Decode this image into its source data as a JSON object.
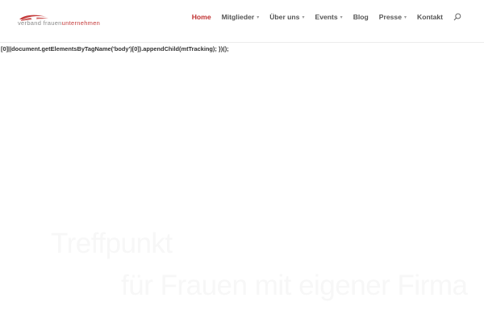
{
  "logo": {
    "text_part1": "verband frauen",
    "text_part2": "unternehmen",
    "brand_color": "#c43a3a"
  },
  "nav": {
    "items": [
      {
        "label": "Home",
        "active": true,
        "has_dropdown": false
      },
      {
        "label": "Mitglieder",
        "active": false,
        "has_dropdown": true
      },
      {
        "label": "Über uns",
        "active": false,
        "has_dropdown": true
      },
      {
        "label": "Events",
        "active": false,
        "has_dropdown": true
      },
      {
        "label": "Blog",
        "active": false,
        "has_dropdown": false
      },
      {
        "label": "Presse",
        "active": false,
        "has_dropdown": true
      },
      {
        "label": "Kontakt",
        "active": false,
        "has_dropdown": false
      }
    ],
    "active_color": "#c03030",
    "search_icon": "search-icon"
  },
  "leak_text": "[0]||document.getElementsByTagName('body')[0]).appendChild(mtTracking); })();",
  "hero": {
    "line1": "Treffpunkt",
    "line2": "für Frauen mit eigener Firma"
  }
}
